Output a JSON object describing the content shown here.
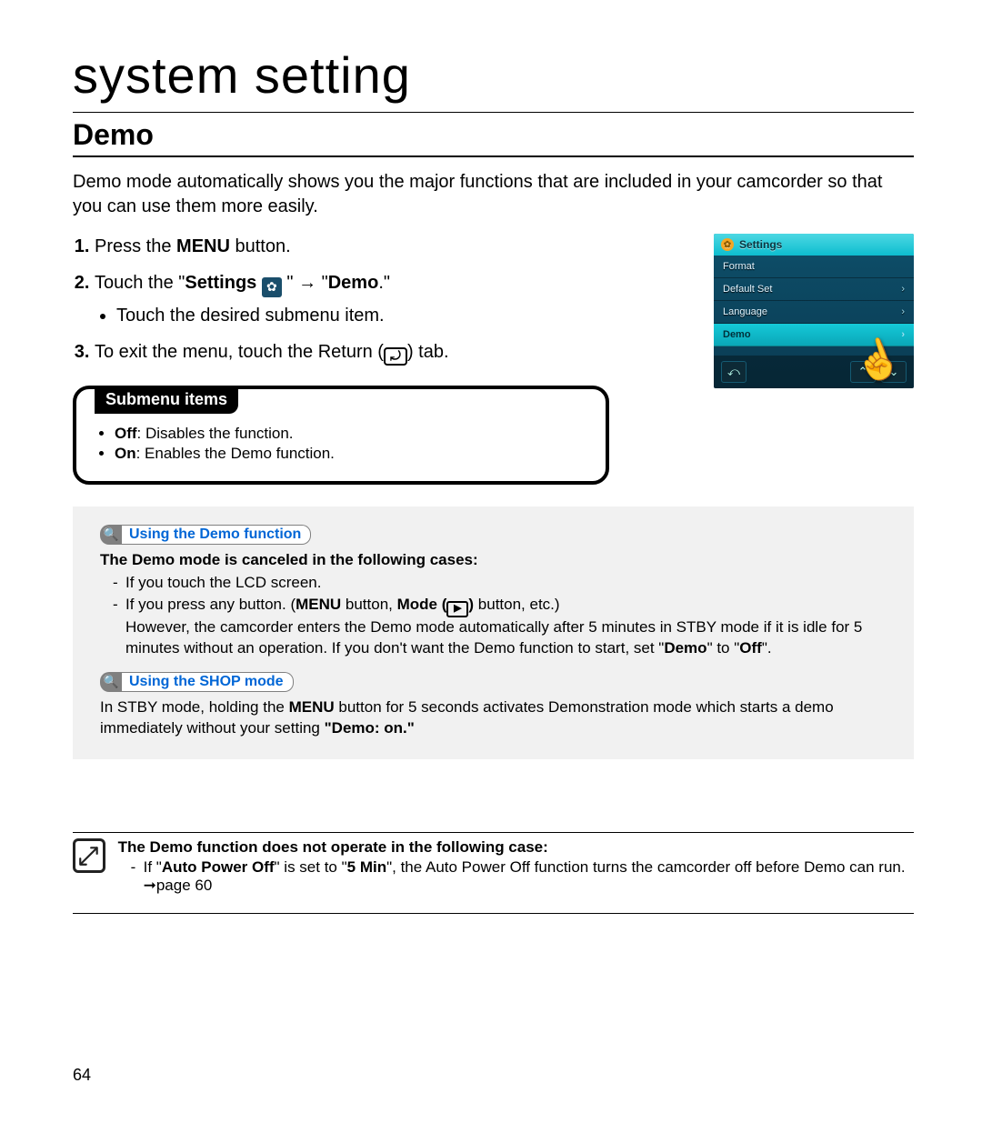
{
  "page_title": "system setting",
  "heading": "Demo",
  "intro": "Demo mode automatically shows you the major functions that are included in your camcorder so that you can use them more easily.",
  "steps": {
    "s1": {
      "prefix": "Press the ",
      "menu": "MENU",
      "suffix": " button."
    },
    "s2": {
      "prefix": "Touch the \"",
      "settings_label": "Settings",
      "mid": " \" → \"",
      "demo": "Demo",
      "suffix": ".\"",
      "sub": "Touch the desired submenu item."
    },
    "s3": {
      "prefix": "To exit the menu, touch the Return (",
      "suffix": ") tab."
    }
  },
  "screen": {
    "header": "Settings",
    "rows": [
      "Format",
      "Default Set",
      "Language",
      "Demo"
    ]
  },
  "submenu": {
    "title": "Submenu items",
    "off_label": "Off",
    "off_desc": ": Disables the function.",
    "on_label": "On",
    "on_desc": ": Enables the Demo function."
  },
  "panel": {
    "t1": "Using the Demo function",
    "lead": "The Demo mode is canceled in the following cases:",
    "li1": "If you touch the LCD screen.",
    "li2_a": "If you press any button. (",
    "li2_menu": "MENU",
    "li2_b": " button, ",
    "li2_mode": "Mode (",
    "li2_c": ")",
    "li2_d": " button, etc.)",
    "li2_cont_a": "However, the camcorder enters the Demo mode automatically after 5 minutes in STBY mode if it is idle for 5 minutes without an operation. If you don't want the Demo function to start, set \"",
    "li2_demo": "Demo",
    "li2_cont_b": "\" to \"",
    "li2_off": "Off",
    "li2_cont_c": "\".",
    "t2": "Using the SHOP mode",
    "p2_a": "In STBY mode, holding the ",
    "p2_menu": "MENU",
    "p2_b": " button for 5 seconds activates Demonstration mode which starts a demo immediately without your setting ",
    "p2_demo_on": "\"Demo: on.\""
  },
  "note": {
    "lead": "The Demo function does not operate in the following case:",
    "li_a": "If \"",
    "apo": "Auto Power Off",
    "li_b": "\" is set to \"",
    "fivemin": "5 Min",
    "li_c": "\", the Auto Power Off function turns the camcorder off before Demo can run. ➞",
    "page_ref": "page 60"
  },
  "page_number": "64"
}
